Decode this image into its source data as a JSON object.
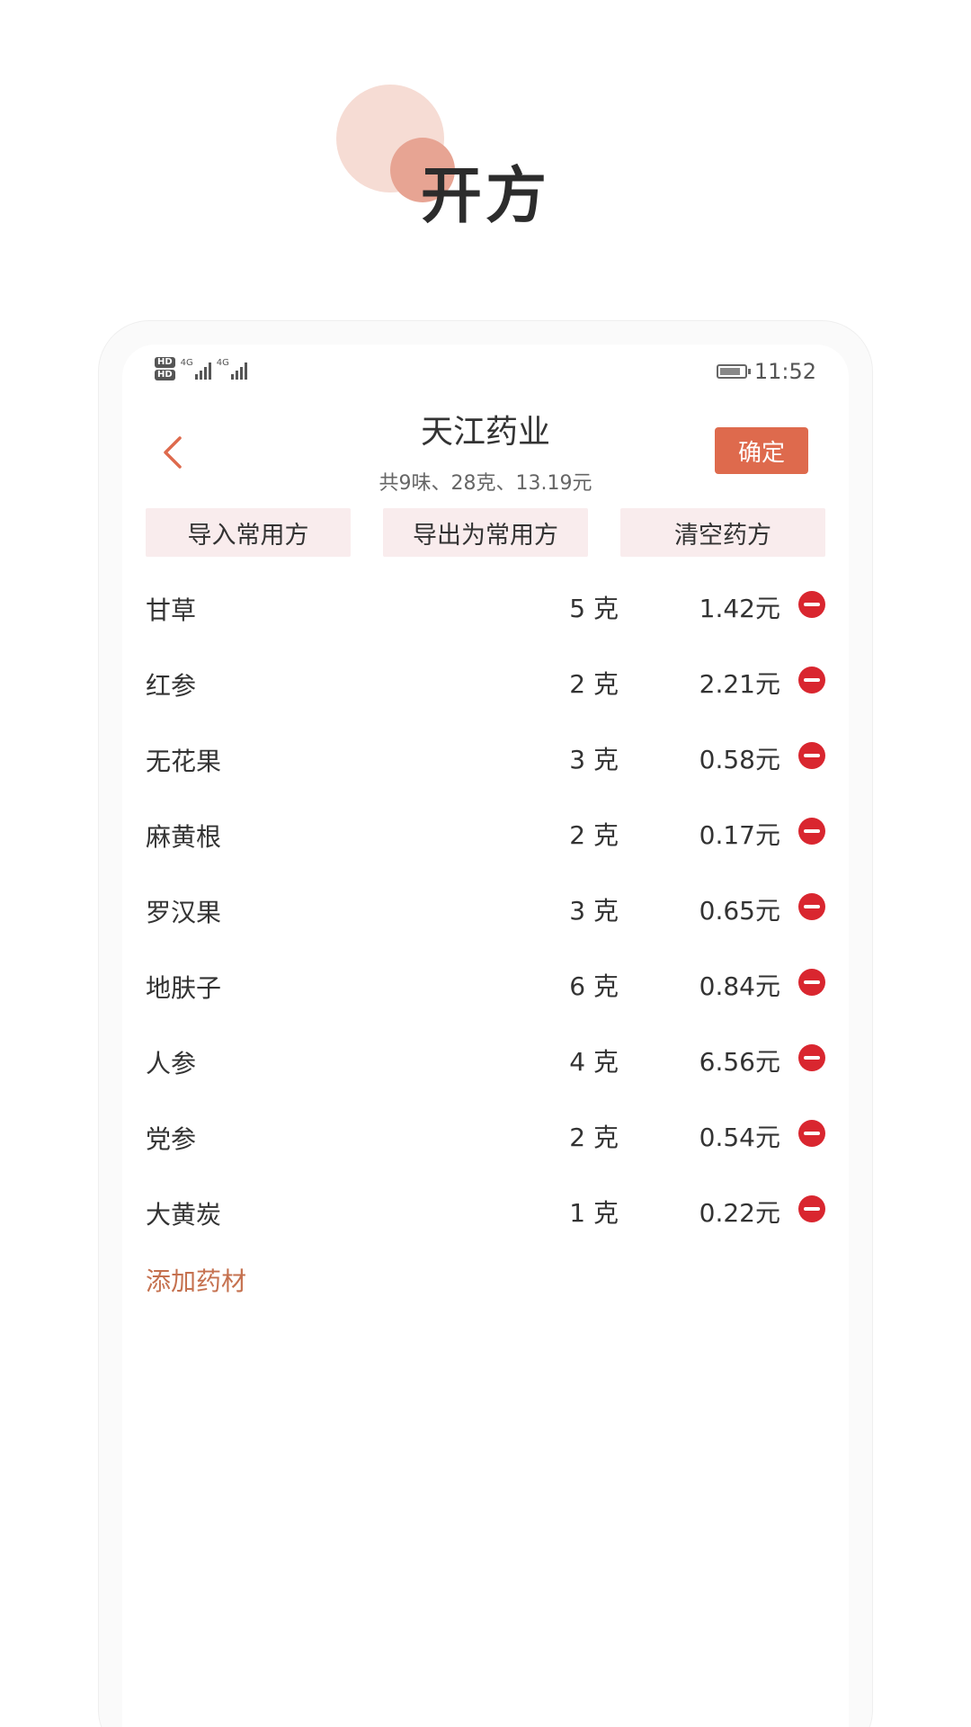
{
  "page_title": "开方",
  "status": {
    "time": "11:52",
    "hd1": "HD",
    "hd2": "HD",
    "net1": "4G",
    "net2": "4G"
  },
  "header": {
    "store_name": "天江药业",
    "summary": "共9味、28克、13.19元",
    "confirm_label": "确定"
  },
  "actions": [
    {
      "label": "导入常用方"
    },
    {
      "label": "导出为常用方"
    },
    {
      "label": "清空药方"
    }
  ],
  "items": [
    {
      "name": "甘草",
      "qty": "5 克",
      "price": "1.42元"
    },
    {
      "name": "红参",
      "qty": "2 克",
      "price": "2.21元"
    },
    {
      "name": "无花果",
      "qty": "3 克",
      "price": "0.58元"
    },
    {
      "name": "麻黄根",
      "qty": "2 克",
      "price": "0.17元"
    },
    {
      "name": "罗汉果",
      "qty": "3 克",
      "price": "0.65元"
    },
    {
      "name": "地肤子",
      "qty": "6 克",
      "price": "0.84元"
    },
    {
      "name": "人参",
      "qty": "4 克",
      "price": "6.56元"
    },
    {
      "name": "党参",
      "qty": "2 克",
      "price": "0.54元"
    },
    {
      "name": "大黄炭",
      "qty": "1 克",
      "price": "0.22元"
    }
  ],
  "add_label": "添加药材",
  "colors": {
    "accent": "#de6a4d",
    "delete": "#d9262f",
    "link": "#c5714f",
    "action_bg": "#f9eced"
  }
}
